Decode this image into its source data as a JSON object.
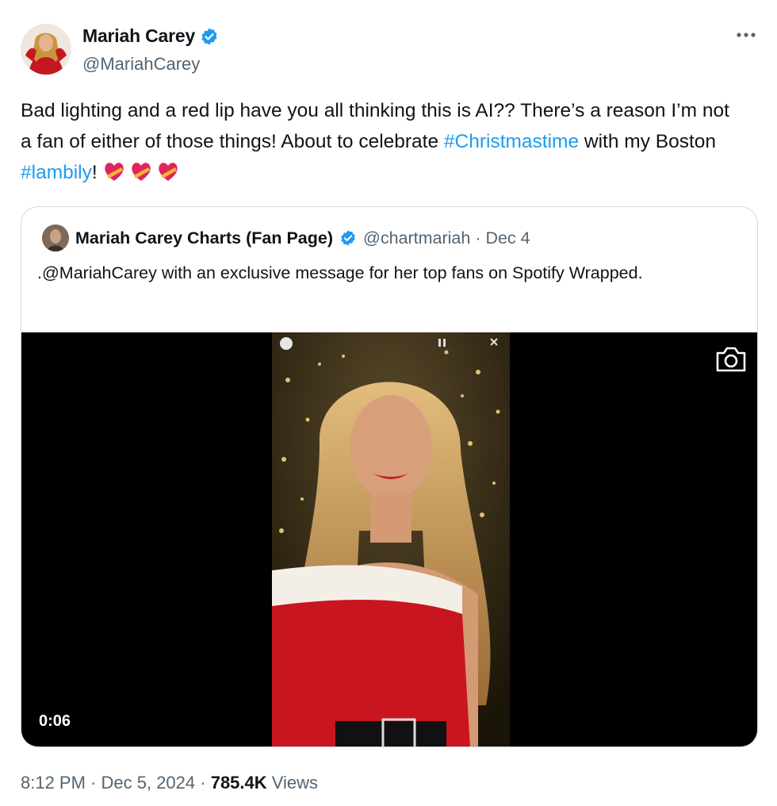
{
  "author": {
    "display_name": "Mariah Carey",
    "handle": "@MariahCarey",
    "verified_icon": "verified-badge-icon"
  },
  "tweet": {
    "text_1": "Bad lighting and a red lip have you all thinking this is AI?? There’s a reason I’m not a fan of either of those things! About to celebrate ",
    "hashtag_1": "#Christmastime",
    "text_2": " with my Boston ",
    "hashtag_2": "#lambily",
    "text_3": "!",
    "emoji_icons": [
      "heart-with-ribbon-icon",
      "heart-with-ribbon-icon",
      "heart-with-ribbon-icon"
    ]
  },
  "quoted": {
    "display_name": "Mariah Carey Charts (Fan Page)",
    "handle_date": "@chartmariah · Dec 4",
    "text": ".@MariahCarey with an exclusive message for her top fans on Spotify Wrapped.",
    "video_time": "0:06",
    "media_icon": "camera-icon"
  },
  "meta": {
    "time": "8:12 PM",
    "sep1": " · ",
    "date": "Dec 5, 2024",
    "sep2": " · ",
    "views_count": "785.4K",
    "views_label": " Views"
  },
  "colors": {
    "link": "#1d9bf0",
    "verified": "#1d9bf0",
    "secondary_text": "#536471",
    "border": "#cfd9de"
  }
}
